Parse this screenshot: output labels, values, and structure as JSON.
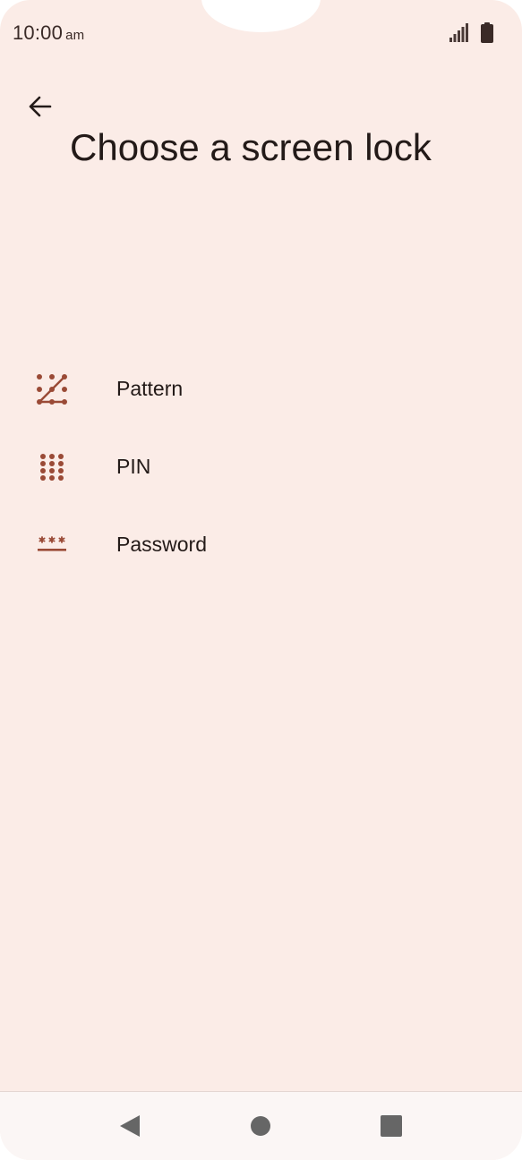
{
  "status_bar": {
    "time": "10:00",
    "ampm": "am"
  },
  "header": {
    "back_icon": "arrow-left-icon",
    "title": "Choose a screen lock"
  },
  "options": [
    {
      "label": "Pattern",
      "icon": "pattern-icon"
    },
    {
      "label": "PIN",
      "icon": "pin-icon"
    },
    {
      "label": "Password",
      "icon": "password-icon"
    }
  ],
  "nav_bar": {
    "back": "nav-back-icon",
    "home": "nav-home-icon",
    "recents": "nav-recents-icon"
  },
  "colors": {
    "background": "#fbece7",
    "icon_accent": "#9a4a36",
    "text": "#231a18"
  }
}
